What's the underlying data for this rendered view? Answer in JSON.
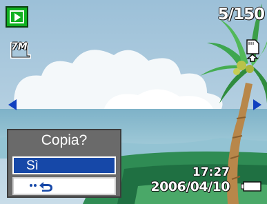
{
  "status": {
    "mode_icon": "playback-icon",
    "image_counter": "5/150",
    "resolution_label": "7M",
    "memory_icon": "internal-memory-icon",
    "time": "17:27",
    "date": "2006/04/10",
    "battery_icon": "battery-icon",
    "battery_level": 1.0
  },
  "navigation": {
    "prev_icon": "left-arrow-icon",
    "next_icon": "right-arrow-icon"
  },
  "dialog": {
    "title": "Copia?",
    "options": [
      {
        "label": "Sì",
        "selected": true
      },
      {
        "label": "",
        "icon": "return-icon",
        "selected": false
      }
    ]
  },
  "colors": {
    "selection": "#1648a8",
    "play_button": "#10b020",
    "nav_arrows": "#1040c0",
    "dialog_bg": "#6a6a6a"
  }
}
